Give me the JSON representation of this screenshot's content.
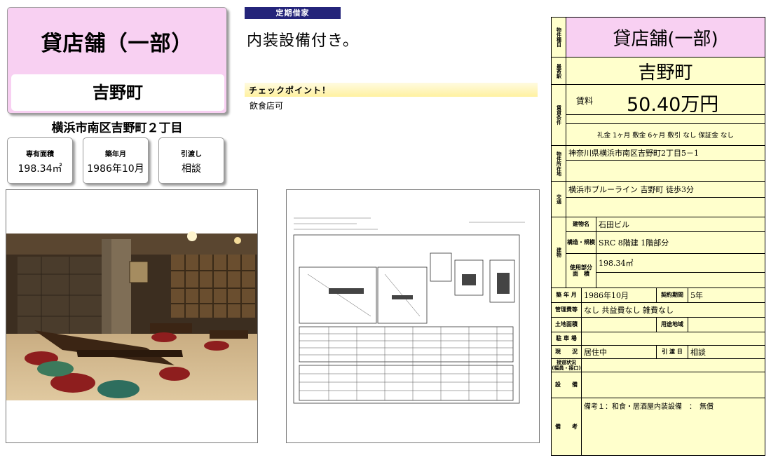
{
  "summary": {
    "property_type": "貸店舗（一部）",
    "town": "吉野町",
    "address": "横浜市南区吉野町２丁目",
    "boxes": [
      {
        "label": "専有面積",
        "value": "198.34㎡"
      },
      {
        "label": "築年月",
        "value": "1986年10月"
      },
      {
        "label": "引渡し",
        "value": "相談"
      }
    ]
  },
  "middle": {
    "badge": "定期借家",
    "headline": "内装設備付き。",
    "checkpoint": "チェックポイント！",
    "note": "飲食店可"
  },
  "sheet": {
    "type_label": "物件種目",
    "type_value": "貸店舗(一部)",
    "station_label": "最寄駅",
    "station_value": "吉野町",
    "terms_label": "賃貸条件",
    "rent_label": "賃料",
    "rent_value": "50.40万円",
    "fees": "礼金 1ヶ月  敷金 6ヶ月  敷引 なし  保証金 なし",
    "location_label": "物件所在地",
    "location_value": "神奈川県横浜市南区吉野町2丁目5－1",
    "transport_label": "交通",
    "transport_value": "横浜市ブルーライン 吉野町 徒歩3分",
    "building_label": "建物",
    "building_name_label": "建物名",
    "building_name": "石田ビル",
    "structure_label": "構造・規模",
    "structure_value": "SRC 8階建 1階部分",
    "area_label": "使用部分\n面　積",
    "area_value": "198.34㎡",
    "built_label": "築 年 月",
    "built_value": "1986年10月",
    "contract_label": "契約期間",
    "contract_value": "5年",
    "mgmt_label": "管理費等",
    "mgmt_value": "なし  共益費なし  雑費なし",
    "land_label": "土地面積",
    "zoning_label": "用途地域",
    "parking_label": "駐 車 場",
    "status_label": "現　　況",
    "status_value": "居住中",
    "handover_label": "引 渡 日",
    "handover_value": "相談",
    "arrange_label": "接道状況\n(幅員・接口)",
    "facilities_label": "設　　備",
    "remarks_label": "備　　考",
    "remarks_value": "備考１：和食・居酒屋内装設備　：　無償"
  },
  "colors": {
    "pink": "#f8d0f2",
    "yellow": "#ffffcc",
    "badge": "#24247a"
  }
}
